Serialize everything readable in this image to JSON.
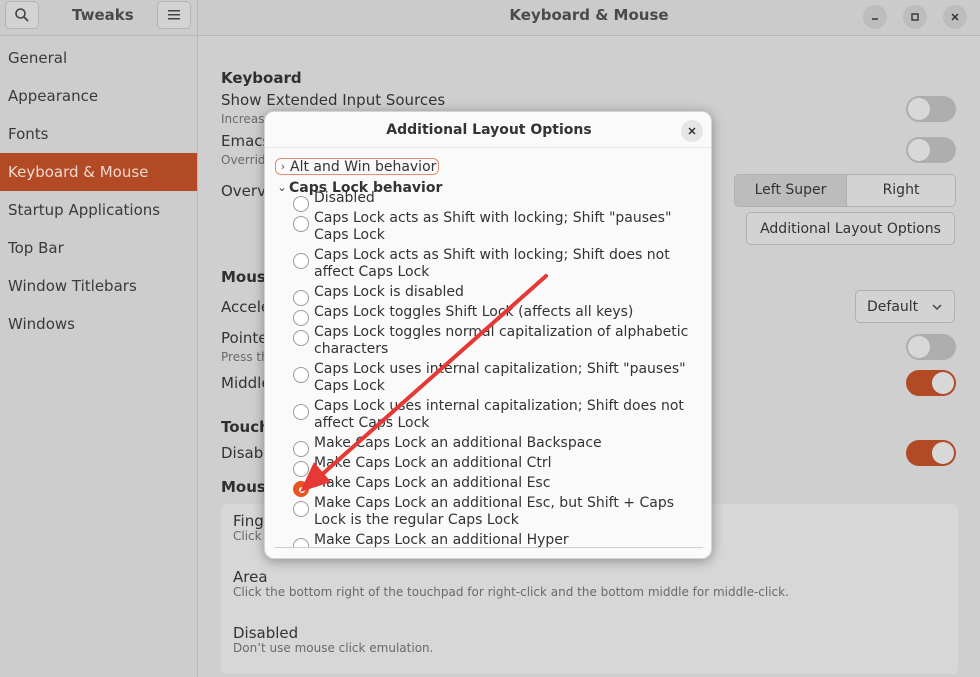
{
  "window": {
    "app_title": "Tweaks",
    "page_title": "Keyboard & Mouse",
    "minimize_icon": "minimize-icon",
    "maximize_icon": "maximize-icon",
    "close_icon": "close-icon"
  },
  "sidebar": {
    "items": [
      {
        "label": "General",
        "active": false
      },
      {
        "label": "Appearance",
        "active": false
      },
      {
        "label": "Fonts",
        "active": false
      },
      {
        "label": "Keyboard & Mouse",
        "active": true
      },
      {
        "label": "Startup Applications",
        "active": false
      },
      {
        "label": "Top Bar",
        "active": false
      },
      {
        "label": "Window Titlebars",
        "active": false
      },
      {
        "label": "Windows",
        "active": false
      }
    ]
  },
  "content": {
    "keyboard_title": "Keyboard",
    "show_ext_title": "Show Extended Input Sources",
    "show_ext_sub": "Increase",
    "emacs_title": "Emacs",
    "emacs_sub": "Overrid",
    "overview_title": "Overvi",
    "left_super": "Left Super",
    "right_super": "Right Super",
    "additional_layout_button": "Additional Layout Options",
    "mouse_title": "Mouse",
    "accel_title": "Accele",
    "accel_value": "Default",
    "pointer_title": "Pointe",
    "pointer_sub": "Press th",
    "middle_title": "Middle",
    "touchpad_title": "Touch",
    "disable_title": "Disabl",
    "mouse_click_title": "Mouse",
    "finger_title": "Finge",
    "finger_sub": "Click",
    "area_title": "Area",
    "area_sub": "Click the bottom right of the touchpad for right-click and the bottom middle for middle-click.",
    "disabled_title": "Disabled",
    "disabled_sub": "Don’t use mouse click emulation."
  },
  "dialog": {
    "title": "Additional Layout Options",
    "alt_win": "Alt and Win behavior",
    "caps_behavior": "Caps Lock behavior",
    "options": [
      {
        "label": "Disabled",
        "selected": false
      },
      {
        "label": "Caps Lock acts as Shift with locking; Shift \"pauses\" Caps Lock",
        "selected": false
      },
      {
        "label": "Caps Lock acts as Shift with locking; Shift does not affect Caps Lock",
        "selected": false
      },
      {
        "label": "Caps Lock is disabled",
        "selected": false
      },
      {
        "label": "Caps Lock toggles Shift Lock (affects all keys)",
        "selected": false
      },
      {
        "label": "Caps Lock toggles normal capitalization of alphabetic characters",
        "selected": false
      },
      {
        "label": "Caps Lock uses internal capitalization; Shift \"pauses\" Caps Lock",
        "selected": false
      },
      {
        "label": "Caps Lock uses internal capitalization; Shift does not affect Caps Lock",
        "selected": false
      },
      {
        "label": "Make Caps Lock an additional Backspace",
        "selected": false
      },
      {
        "label": "Make Caps Lock an additional Ctrl",
        "selected": false
      },
      {
        "label": "Make Caps Lock an additional Esc",
        "selected": true
      },
      {
        "label": "Make Caps Lock an additional Esc, but Shift + Caps Lock is the regular Caps Lock",
        "selected": false
      },
      {
        "label": "Make Caps Lock an additional Hyper",
        "selected": false
      }
    ]
  },
  "colors": {
    "accent": "#e95420",
    "sidebar_active": "#b24a25",
    "arrow": "#e53935"
  }
}
